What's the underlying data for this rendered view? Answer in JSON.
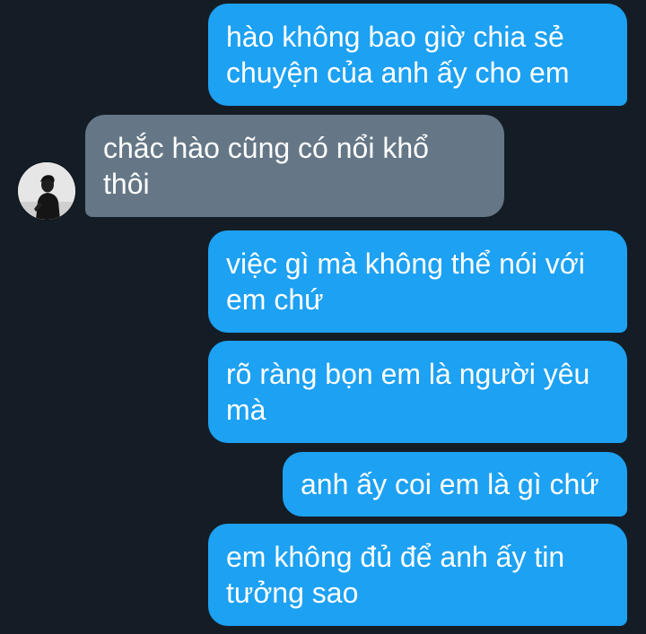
{
  "theme": {
    "background": "#141d26",
    "outgoing_bubble": "#1da1f2",
    "incoming_bubble": "#657786"
  },
  "messages": [
    {
      "direction": "outgoing",
      "text": "hào không bao giờ chia sẻ\nchuyện của anh ấy cho em"
    },
    {
      "direction": "incoming",
      "text": "chắc hào cũng có nổi khổ\nthôi",
      "avatar_icon": "contact-avatar"
    },
    {
      "direction": "outgoing",
      "text": "việc gì mà không thể nói với\nem chứ"
    },
    {
      "direction": "outgoing",
      "text": "rõ ràng bọn em là người yêu\nmà"
    },
    {
      "direction": "outgoing",
      "text": "anh ấy coi em là gì chứ"
    },
    {
      "direction": "outgoing",
      "text": "em không đủ để anh ấy tin\ntưởng sao"
    }
  ]
}
